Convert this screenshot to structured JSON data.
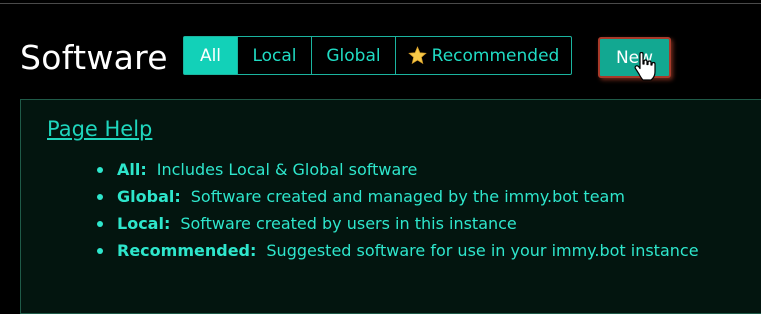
{
  "page": {
    "title": "Software"
  },
  "tabs": [
    {
      "label": "All",
      "active": true
    },
    {
      "label": "Local",
      "active": false
    },
    {
      "label": "Global",
      "active": false
    },
    {
      "label": "Recommended",
      "active": false,
      "icon": "star-icon"
    }
  ],
  "actions": {
    "new_label": "New"
  },
  "help": {
    "link_label": "Page Help",
    "items": [
      {
        "term": "All:",
        "description": "Includes Local & Global software"
      },
      {
        "term": "Global:",
        "description": "Software created and managed by the immy.bot team"
      },
      {
        "term": "Local:",
        "description": "Software created by users in this instance"
      },
      {
        "term": "Recommended:",
        "description": "Suggested software for use in your immy.bot instance"
      }
    ]
  },
  "colors": {
    "accent": "#12d1b8",
    "accent_text": "#20dcc4",
    "panel_bg": "#03150f",
    "new_button_bg": "#12a891"
  }
}
